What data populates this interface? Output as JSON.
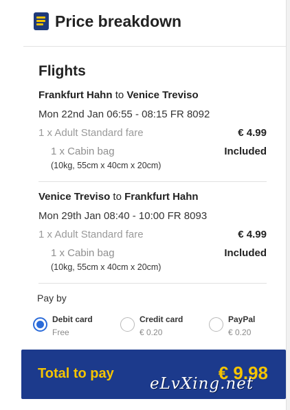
{
  "header": {
    "title": "Price breakdown",
    "icon": "document-icon"
  },
  "flights": {
    "title": "Flights",
    "legs": [
      {
        "from": "Frankfurt Hahn",
        "connector": "to",
        "to": "Venice Treviso",
        "date_line": "Mon 22nd Jan 06:55 - 08:15 FR 8092",
        "fare_label": "1 x Adult Standard fare",
        "fare_value": "€ 4.99",
        "bag_label": "1 x Cabin bag",
        "bag_value": "Included",
        "bag_dims": "(10kg, 55cm x 40cm x 20cm)"
      },
      {
        "from": "Venice Treviso",
        "connector": "to",
        "to": "Frankfurt Hahn",
        "date_line": "Mon 29th Jan 08:40 - 10:00 FR 8093",
        "fare_label": "1 x Adult Standard fare",
        "fare_value": "€ 4.99",
        "bag_label": "1 x Cabin bag",
        "bag_value": "Included",
        "bag_dims": "(10kg, 55cm x 40cm x 20cm)"
      }
    ]
  },
  "payment": {
    "label": "Pay by",
    "options": [
      {
        "name": "Debit card",
        "fee": "Free",
        "selected": true
      },
      {
        "name": "Credit card",
        "fee": "€ 0.20",
        "selected": false
      },
      {
        "name": "PayPal",
        "fee": "€ 0.20",
        "selected": false
      }
    ]
  },
  "total": {
    "label": "Total to pay",
    "value": "€ 9.98"
  },
  "watermark": "eLvXing.net",
  "colors": {
    "brand_blue": "#1c3a8c",
    "accent_yellow": "#f5c400",
    "radio_blue": "#2b6bd9"
  }
}
